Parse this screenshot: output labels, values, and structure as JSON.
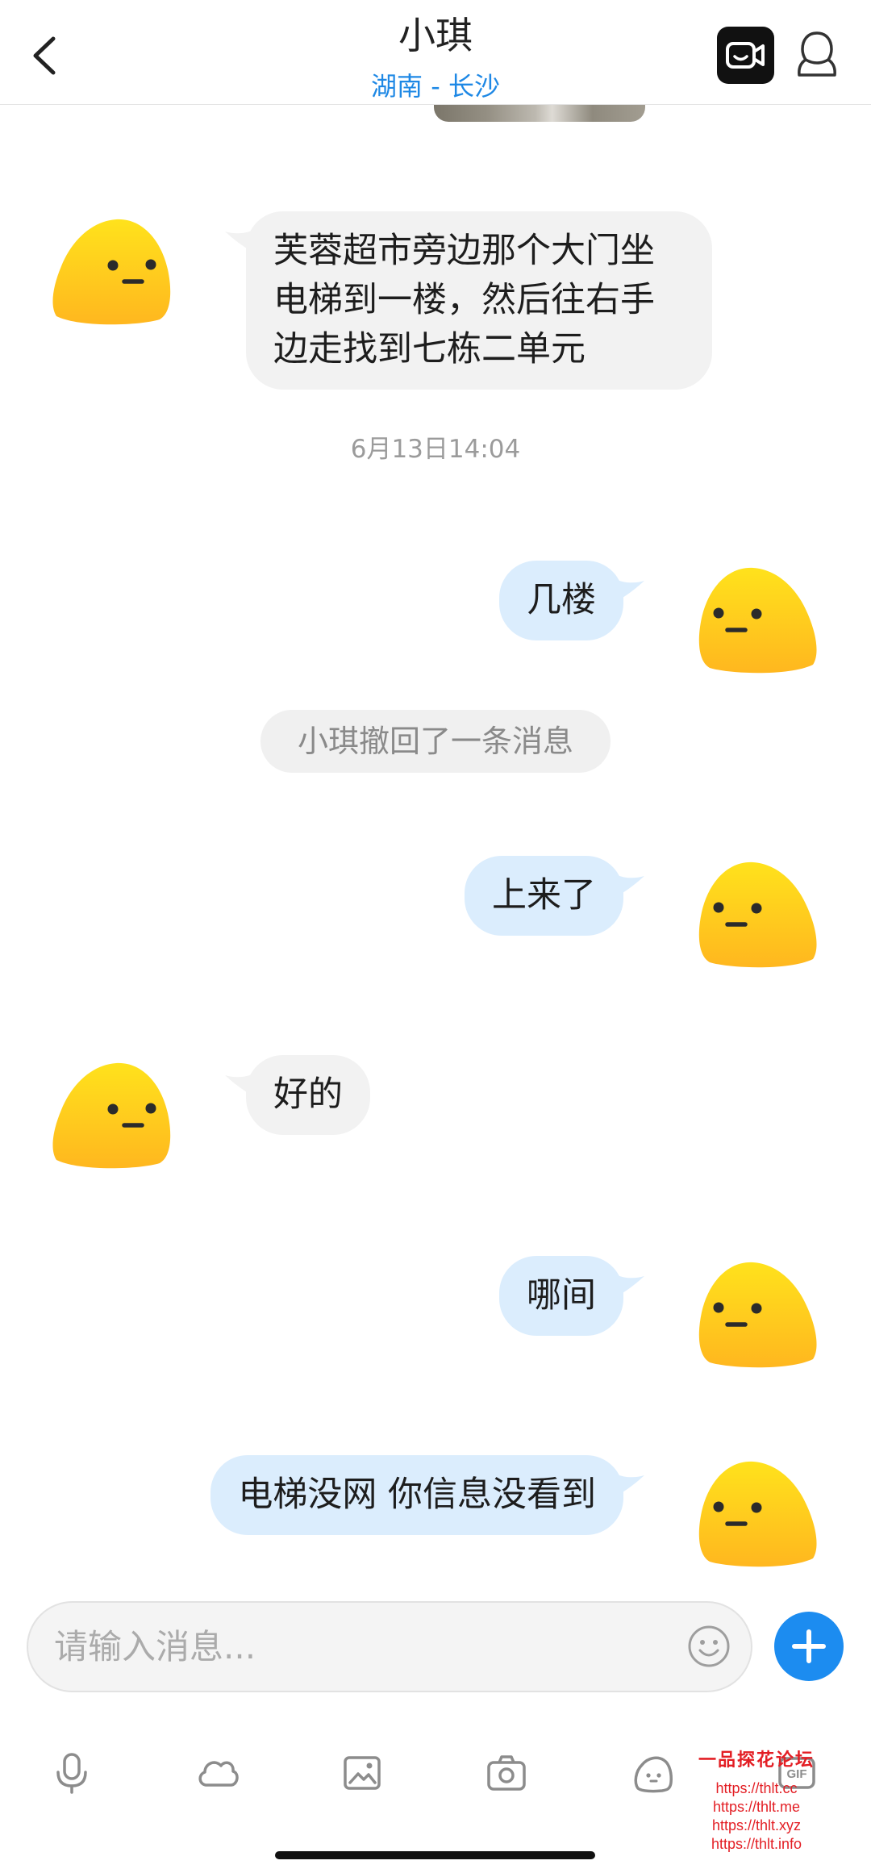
{
  "header": {
    "title": "小琪",
    "subtitle": "湖南 - 长沙",
    "icons": {
      "back": "chevron-left-icon",
      "video": "video-call-icon",
      "profile": "profile-icon"
    }
  },
  "thread": [
    {
      "outgoing": false,
      "text": "芙蓉超市旁边那个大门坐电梯到一楼，然后往右手边走找到七栋二单元"
    },
    {
      "timestamp": "6月13日14:04"
    },
    {
      "outgoing": true,
      "text": "几楼"
    },
    {
      "notice": "小琪撤回了一条消息"
    },
    {
      "outgoing": true,
      "text": "上来了"
    },
    {
      "outgoing": false,
      "text": "好的"
    },
    {
      "outgoing": true,
      "text": "哪间"
    },
    {
      "outgoing": true,
      "text": "电梯没网 你信息没看到"
    }
  ],
  "avatar_icon": "yellow-blob-avatar-icon",
  "composer": {
    "placeholder": "请输入消息...",
    "emoji_icon": "smiley-icon",
    "send_more_icon": "plus-icon"
  },
  "toolbar": {
    "icons": [
      "microphone-icon",
      "cloud-icon",
      "image-icon",
      "camera-icon",
      "sticker-face-icon",
      "gif-icon"
    ],
    "gif_label": "GIF"
  },
  "watermark": {
    "title": "一品探花论坛",
    "urls": [
      "https://thlt.cc",
      "https://thlt.me",
      "https://thlt.xyz",
      "https://thlt.info"
    ]
  },
  "colors": {
    "accent": "#1E88E5",
    "accent_button": "#1C8CF0",
    "incoming_bubble": "#F2F2F2",
    "outgoing_bubble": "#DBEDFD",
    "watermark": "#E31E24",
    "avatar_top": "#FFE21C",
    "avatar_bottom": "#FFB71F",
    "icon_gray": "#8C8C8C"
  }
}
